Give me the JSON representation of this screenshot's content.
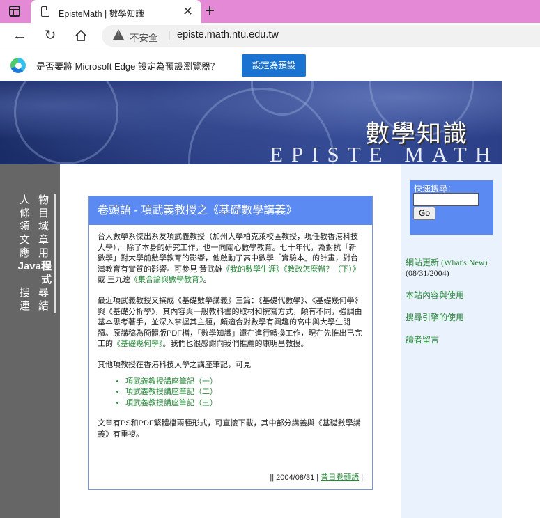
{
  "browser": {
    "tab_title": "EpisteMath | 數學知識",
    "tab_close": "✕",
    "new_tab": "+",
    "security_label": "不安全",
    "url": "episte.math.ntu.edu.tw"
  },
  "infobar": {
    "message": "是否要將 Microsoft Edge 設定為預設瀏覽器？",
    "button_label": "設定為預設",
    "accent": "#1a73d1"
  },
  "banner": {
    "title": "數學知識",
    "subtitle": "EPISTE MATH"
  },
  "sidebar": {
    "items": [
      "人 物",
      "條 目",
      "領 域",
      "文 章",
      "應 用",
      "Java程式",
      "搜 尋",
      "連 結"
    ]
  },
  "article": {
    "heading": "卷頭語 - 項武義教授之《基礎數學講義》",
    "p1_a": "台大數學系傑出系友項武義教授（加州大學柏克萊校區教授，現任教香港科技大學）， 除了本身的研究工作，也一向關心數學教育。七十年代，為對抗「新數學」對大學前數學教育的影響，他啟動了高中數學「實驗本」的計畫，對台灣教育有實質的影響。可參見 黃武雄",
    "link_1": "《我的數學生涯》",
    "link_2": "《教改怎麼辦？（下）》",
    "p1_b": "或 王九逵",
    "link_3": "《集合論與數學教育》",
    "p1_c": "。",
    "p2_a": "最近項武義教授又撰成《基礎數學講義》三篇：《基礎代數學》、《基礎幾何學》與《基礎分析學》，其內容與一般教科書的取材和撰寫方式，頗有不同，強調由基本思考著手，並深入掌握其主題，頗適合對數學有興趣的高中與大學生閱讀。原講稿為簡體版PDF檔，「數學知識」還在進行轉換工作，現在先推出已完工的",
    "link_4": "《基礎幾何學》",
    "p2_b": "。我們也很感謝向我們推薦的康明昌教授。",
    "p3": "其他項教授在香港科技大學之講座筆記，可見",
    "notes": [
      "項武義教授講座筆記（一）",
      "項武義教授講座筆記（二）",
      "項武義教授講座筆記（三）"
    ],
    "p4": "文章有PS和PDF繁體檔兩種形式，可直接下載，其中部分講義與《基礎數學講義》有重複。",
    "footer_pre": "|| 2004/08/31 |",
    "footer_link": "昔日卷頭語",
    "footer_post": "||"
  },
  "rightcol": {
    "search_label": "快速搜尋：",
    "search_value": "",
    "go_label": "Go",
    "whats_new": "網站更新 (What's New)",
    "whats_new_date": "(08/31/2004)",
    "link_content": "本站內容與使用",
    "link_search_engine": "搜尋引擎的使用",
    "link_guestbook": "讀者留言"
  },
  "colors": {
    "tabbar": "#e489d6",
    "card_header": "#5b8af2",
    "link_green": "#2a8a3c",
    "sidebar_gray": "#666666",
    "right_col_bg": "#eaf2fd"
  }
}
